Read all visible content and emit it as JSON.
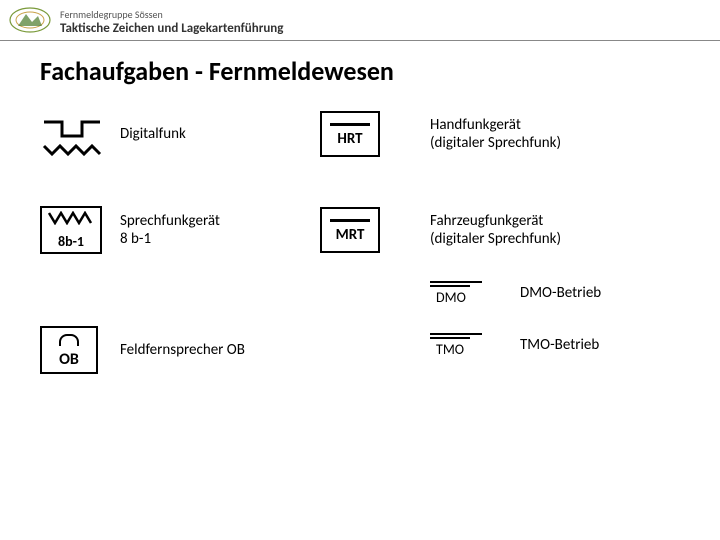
{
  "header": {
    "org": "Fernmeldegruppe Sössen",
    "subtitle": "Taktische Zeichen und Lagekartenführung"
  },
  "title": "Fachaufgaben - Fernmeldewesen",
  "left": {
    "r1": {
      "label": "Digitalfunk"
    },
    "r2": {
      "label_l1": "Sprechfunkgerät",
      "label_l2": "8 b-1",
      "box_text": "8b-1"
    },
    "r3": {
      "label": "Feldfernsprecher OB",
      "box_text": "OB"
    }
  },
  "right": {
    "r1": {
      "box_text": "HRT",
      "label_l1": "Handfunkgerät",
      "label_l2": "(digitaler Sprechfunk)"
    },
    "r2": {
      "box_text": "MRT",
      "label_l1": "Fahrzeugfunkgerät",
      "label_l2": "(digitaler Sprechfunk)"
    },
    "r3": {
      "flag_text": "DMO",
      "label": "DMO-Betrieb"
    },
    "r4": {
      "flag_text": "TMO",
      "label": "TMO-Betrieb"
    }
  }
}
